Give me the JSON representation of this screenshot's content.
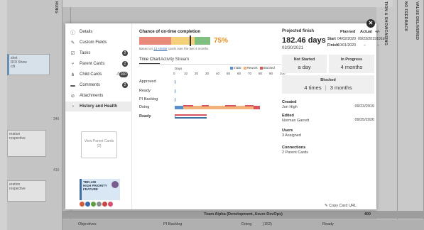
{
  "background": {
    "vertical_labels": [
      "VALUE DELIVERED",
      "NO FEEDBACK",
      "TION & SHOWCASING",
      "RUNG"
    ],
    "footer": {
      "title": "Team Alpha (Development, Azure DevOps)",
      "count": "400"
    },
    "footer_columns": [
      "Objectives",
      "PI Backlog",
      "Doing",
      "(152)",
      "Ready"
    ],
    "left_cards": [
      {
        "line1": "shet",
        "line2": "ROI Show",
        "line3": "cilt"
      },
      {
        "line1": "eration",
        "line2": "rospective"
      },
      {
        "line1": "eration",
        "line2": "rospective"
      }
    ],
    "left_numbers": [
      "340",
      "410"
    ]
  },
  "modal": {
    "close_glyph": "✕",
    "nav": [
      {
        "label": "Details",
        "icon": "ⓘ",
        "icon_name": "info-icon"
      },
      {
        "label": "Custom Fields",
        "icon": "✎",
        "icon_name": "custom-fields-icon"
      },
      {
        "label": "Tasks",
        "icon": "☑",
        "icon_name": "tasks-icon",
        "badge": "2"
      },
      {
        "label": "Parent Cards",
        "icon": "⑂",
        "icon_name": "parent-cards-icon",
        "badge": "2"
      },
      {
        "label": "Child Cards",
        "icon": "⋔",
        "icon_name": "child-cards-icon",
        "badge": "160",
        "warn": "⚠"
      },
      {
        "label": "Comments",
        "icon": "▬",
        "icon_name": "comments-icon",
        "badge": "2"
      },
      {
        "label": "Attachments",
        "icon": "⊘",
        "icon_name": "attachments-icon"
      },
      {
        "label": "History and Health",
        "icon": "◔",
        "icon_name": "history-icon"
      }
    ],
    "view_parent_cards": "View Parent Cards",
    "view_parent_count": "(2)",
    "mini_card": {
      "id": "TBD-439",
      "title": "HIGH PRIORITY FEATURE"
    },
    "chance": {
      "title": "Chance of on-time completion",
      "percent": "75%",
      "percent_value": 75,
      "note_prefix": "Based on",
      "note_link": "13 similar",
      "note_suffix": "cards over the last 4 months",
      "colors": {
        "red": "#e8897a",
        "yellow": "#f4d07a",
        "green": "#7fbf7f"
      }
    },
    "tabs": [
      {
        "label": "Time Chart",
        "active": true
      },
      {
        "label": "Activity Stream",
        "active": false
      }
    ],
    "chart_data": {
      "type": "bar",
      "xlabel": "Days",
      "xticks": [
        "0",
        "10",
        "20",
        "30",
        "40",
        "50",
        "60",
        "70",
        "80",
        "90",
        "100"
      ],
      "xlim": [
        0,
        100
      ],
      "categories": [
        "Approved",
        "Ready",
        "PI Backlog",
        "Doing",
        "Ready"
      ],
      "bold_categories": [
        4
      ],
      "series": [
        {
          "name": "Initial",
          "color": "#5b8fc7",
          "values": [
            0.5,
            0.5,
            0.3,
            8,
            0.5
          ]
        },
        {
          "name": "Rework",
          "color": "#f2b27a",
          "values": [
            0,
            0,
            0,
            66,
            0
          ]
        },
        {
          "name": "Blocked",
          "color": "#d9535f",
          "values": [
            0,
            0,
            0,
            6,
            0
          ]
        }
      ],
      "stripes": {
        "Doing": [
          [
            8,
            17
          ],
          [
            25,
            32
          ],
          [
            47,
            57
          ],
          [
            66,
            74
          ]
        ],
        "Ready": [
          [
            0,
            30
          ]
        ]
      },
      "legend_position": "top-right"
    },
    "projected": {
      "label": "Projected finish",
      "days": "182.46 days",
      "date": "03/30/2021"
    },
    "dates": {
      "headers": [
        "Planned",
        "Actual",
        "+/-"
      ],
      "rows": [
        {
          "label": "Start",
          "planned": "04/02/2020",
          "actual": "09/23/2019",
          "diff": "191d"
        },
        {
          "label": "Finish",
          "planned": "10/01/2020",
          "actual": "–",
          "diff": "–"
        }
      ]
    },
    "stats": {
      "not_started": {
        "title": "Not Started",
        "value": "a day"
      },
      "in_progress": {
        "title": "In Progress",
        "value": "4 months"
      },
      "blocked": {
        "title": "Blocked",
        "value1": "4 times",
        "sep": "|",
        "value2": "3 months"
      }
    },
    "meta": {
      "created": {
        "label": "Created",
        "name": "Jon High",
        "date": "09/23/2019"
      },
      "edited": {
        "label": "Edited",
        "name": "Norman Garrett",
        "date": "09/25/2020"
      },
      "users": {
        "label": "Users",
        "value": "3 Assigned"
      },
      "connections": {
        "label": "Connections",
        "value": "2 Parent Cards"
      }
    },
    "copy_url": "Copy Card URL",
    "copy_icon": "✎"
  }
}
